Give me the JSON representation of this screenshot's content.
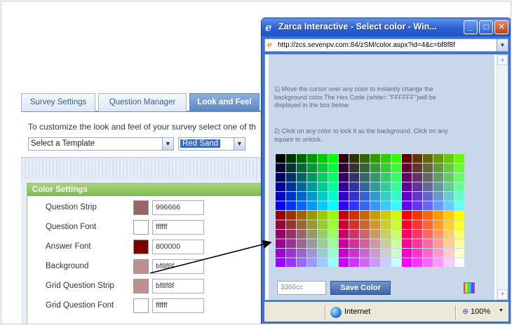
{
  "survey": {
    "tabs": [
      {
        "label": "Survey Settings"
      },
      {
        "label": "Question Manager"
      },
      {
        "label": "Look and Feel"
      }
    ],
    "intro": "To customize the look and feel of your survey select one of th",
    "template_select": "Select a Template",
    "theme_select": "Red Sand",
    "color_settings": {
      "title": "Color Settings",
      "rows": [
        {
          "label": "Question Strip",
          "value": "996666",
          "swatch": "#996666"
        },
        {
          "label": "Question Font",
          "value": "ffffff",
          "swatch": "#ffffff"
        },
        {
          "label": "Answer Font",
          "value": "800000",
          "swatch": "#800000"
        },
        {
          "label": "Background",
          "value": "bf8f8f",
          "swatch": "#bf8f8f"
        },
        {
          "label": "Grid Question Strip",
          "value": "bf8f8f",
          "swatch": "#bf8f8f"
        },
        {
          "label": "Grid Question Font",
          "value": "ffffff",
          "swatch": "#ffffff"
        }
      ]
    }
  },
  "popup": {
    "title": "Zarca Interactive - Select color - Win...",
    "address": "http://zcs.sevenpv.com:84/zSM/color.aspx?id=4&c=bf8f8f",
    "instructions": [
      "1) Move the cursor over any color to instantly change the background color.The Hex Code (white= \"FFFFFF\")will be displayed in the box below.",
      "2) Click on any color to lock it as the background. Click on any square to unlock."
    ],
    "hex_value": "3366cc",
    "save_label": "Save Color",
    "status": {
      "zone": "Internet",
      "zoom": "100%"
    },
    "icons": [
      "ie-icon",
      "minimize-icon",
      "maximize-icon",
      "close-icon",
      "page-icon",
      "globe-icon",
      "zoom-icon",
      "spectrum-icon"
    ]
  }
}
